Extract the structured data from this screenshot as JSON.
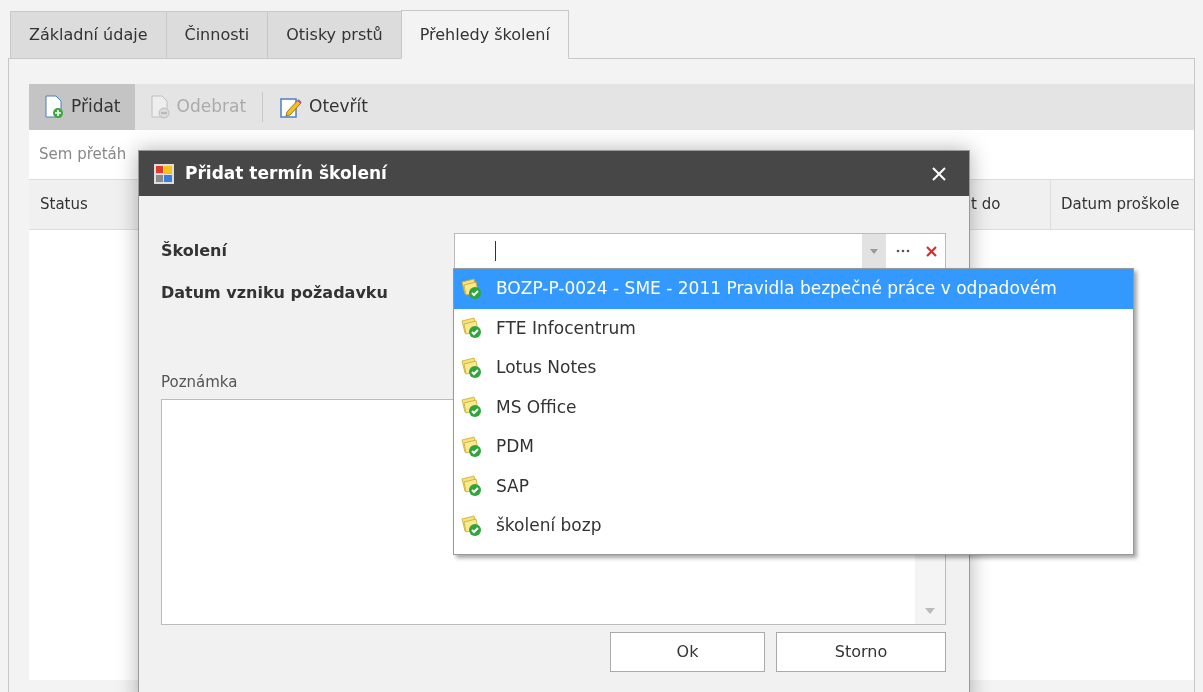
{
  "tabs": [
    {
      "label": "Základní údaje",
      "selected": false
    },
    {
      "label": "Činnosti",
      "selected": false
    },
    {
      "label": "Otisky prstů",
      "selected": false
    },
    {
      "label": "Přehledy školení",
      "selected": true
    }
  ],
  "toolbar": [
    {
      "kind": "add",
      "label": "Přidat",
      "disabled": false,
      "hovered": true
    },
    {
      "kind": "remove",
      "label": "Odebrat",
      "disabled": true,
      "hovered": false
    },
    {
      "kind": "edit",
      "label": "Otevřít",
      "disabled": false,
      "hovered": false
    }
  ],
  "group_panel": {
    "hint": "Sem přetáh"
  },
  "grid": {
    "columns": [
      {
        "label": "Status"
      },
      {
        "label": "t do"
      },
      {
        "label": "Datum proškole"
      }
    ]
  },
  "dialog": {
    "title": "Přidat termín školení",
    "training_field": {
      "label": "Školení"
    },
    "date_field": {
      "label": "Datum vzniku požadavku"
    },
    "note_field": {
      "label": "Poznámka"
    },
    "dropdown": [
      {
        "label": "BOZP-P-0024 - SME - 2011 Pravidla bezpečné práce v odpadovém",
        "selected": true
      },
      {
        "label": "FTE Infocentrum",
        "selected": false
      },
      {
        "label": "Lotus Notes",
        "selected": false
      },
      {
        "label": "MS Office",
        "selected": false
      },
      {
        "label": "PDM",
        "selected": false
      },
      {
        "label": "SAP",
        "selected": false
      },
      {
        "label": "školení bozp",
        "selected": false
      }
    ],
    "buttons": [
      {
        "label": "Ok"
      },
      {
        "label": "Storno"
      }
    ]
  }
}
